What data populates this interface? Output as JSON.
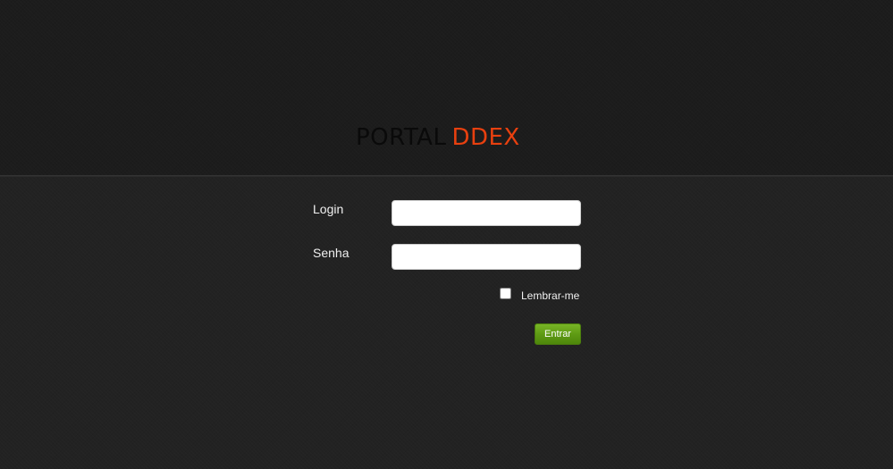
{
  "header": {
    "logo_primary": "PORTAL",
    "logo_accent": "DDEX",
    "logo_accent_color": "#e8400f"
  },
  "login_form": {
    "login_label": "Login",
    "login_value": "",
    "password_label": "Senha",
    "password_value": "",
    "remember_label": "Lembrar-me",
    "remember_checked": false,
    "submit_label": "Entrar",
    "submit_color": "#5f9b14"
  }
}
